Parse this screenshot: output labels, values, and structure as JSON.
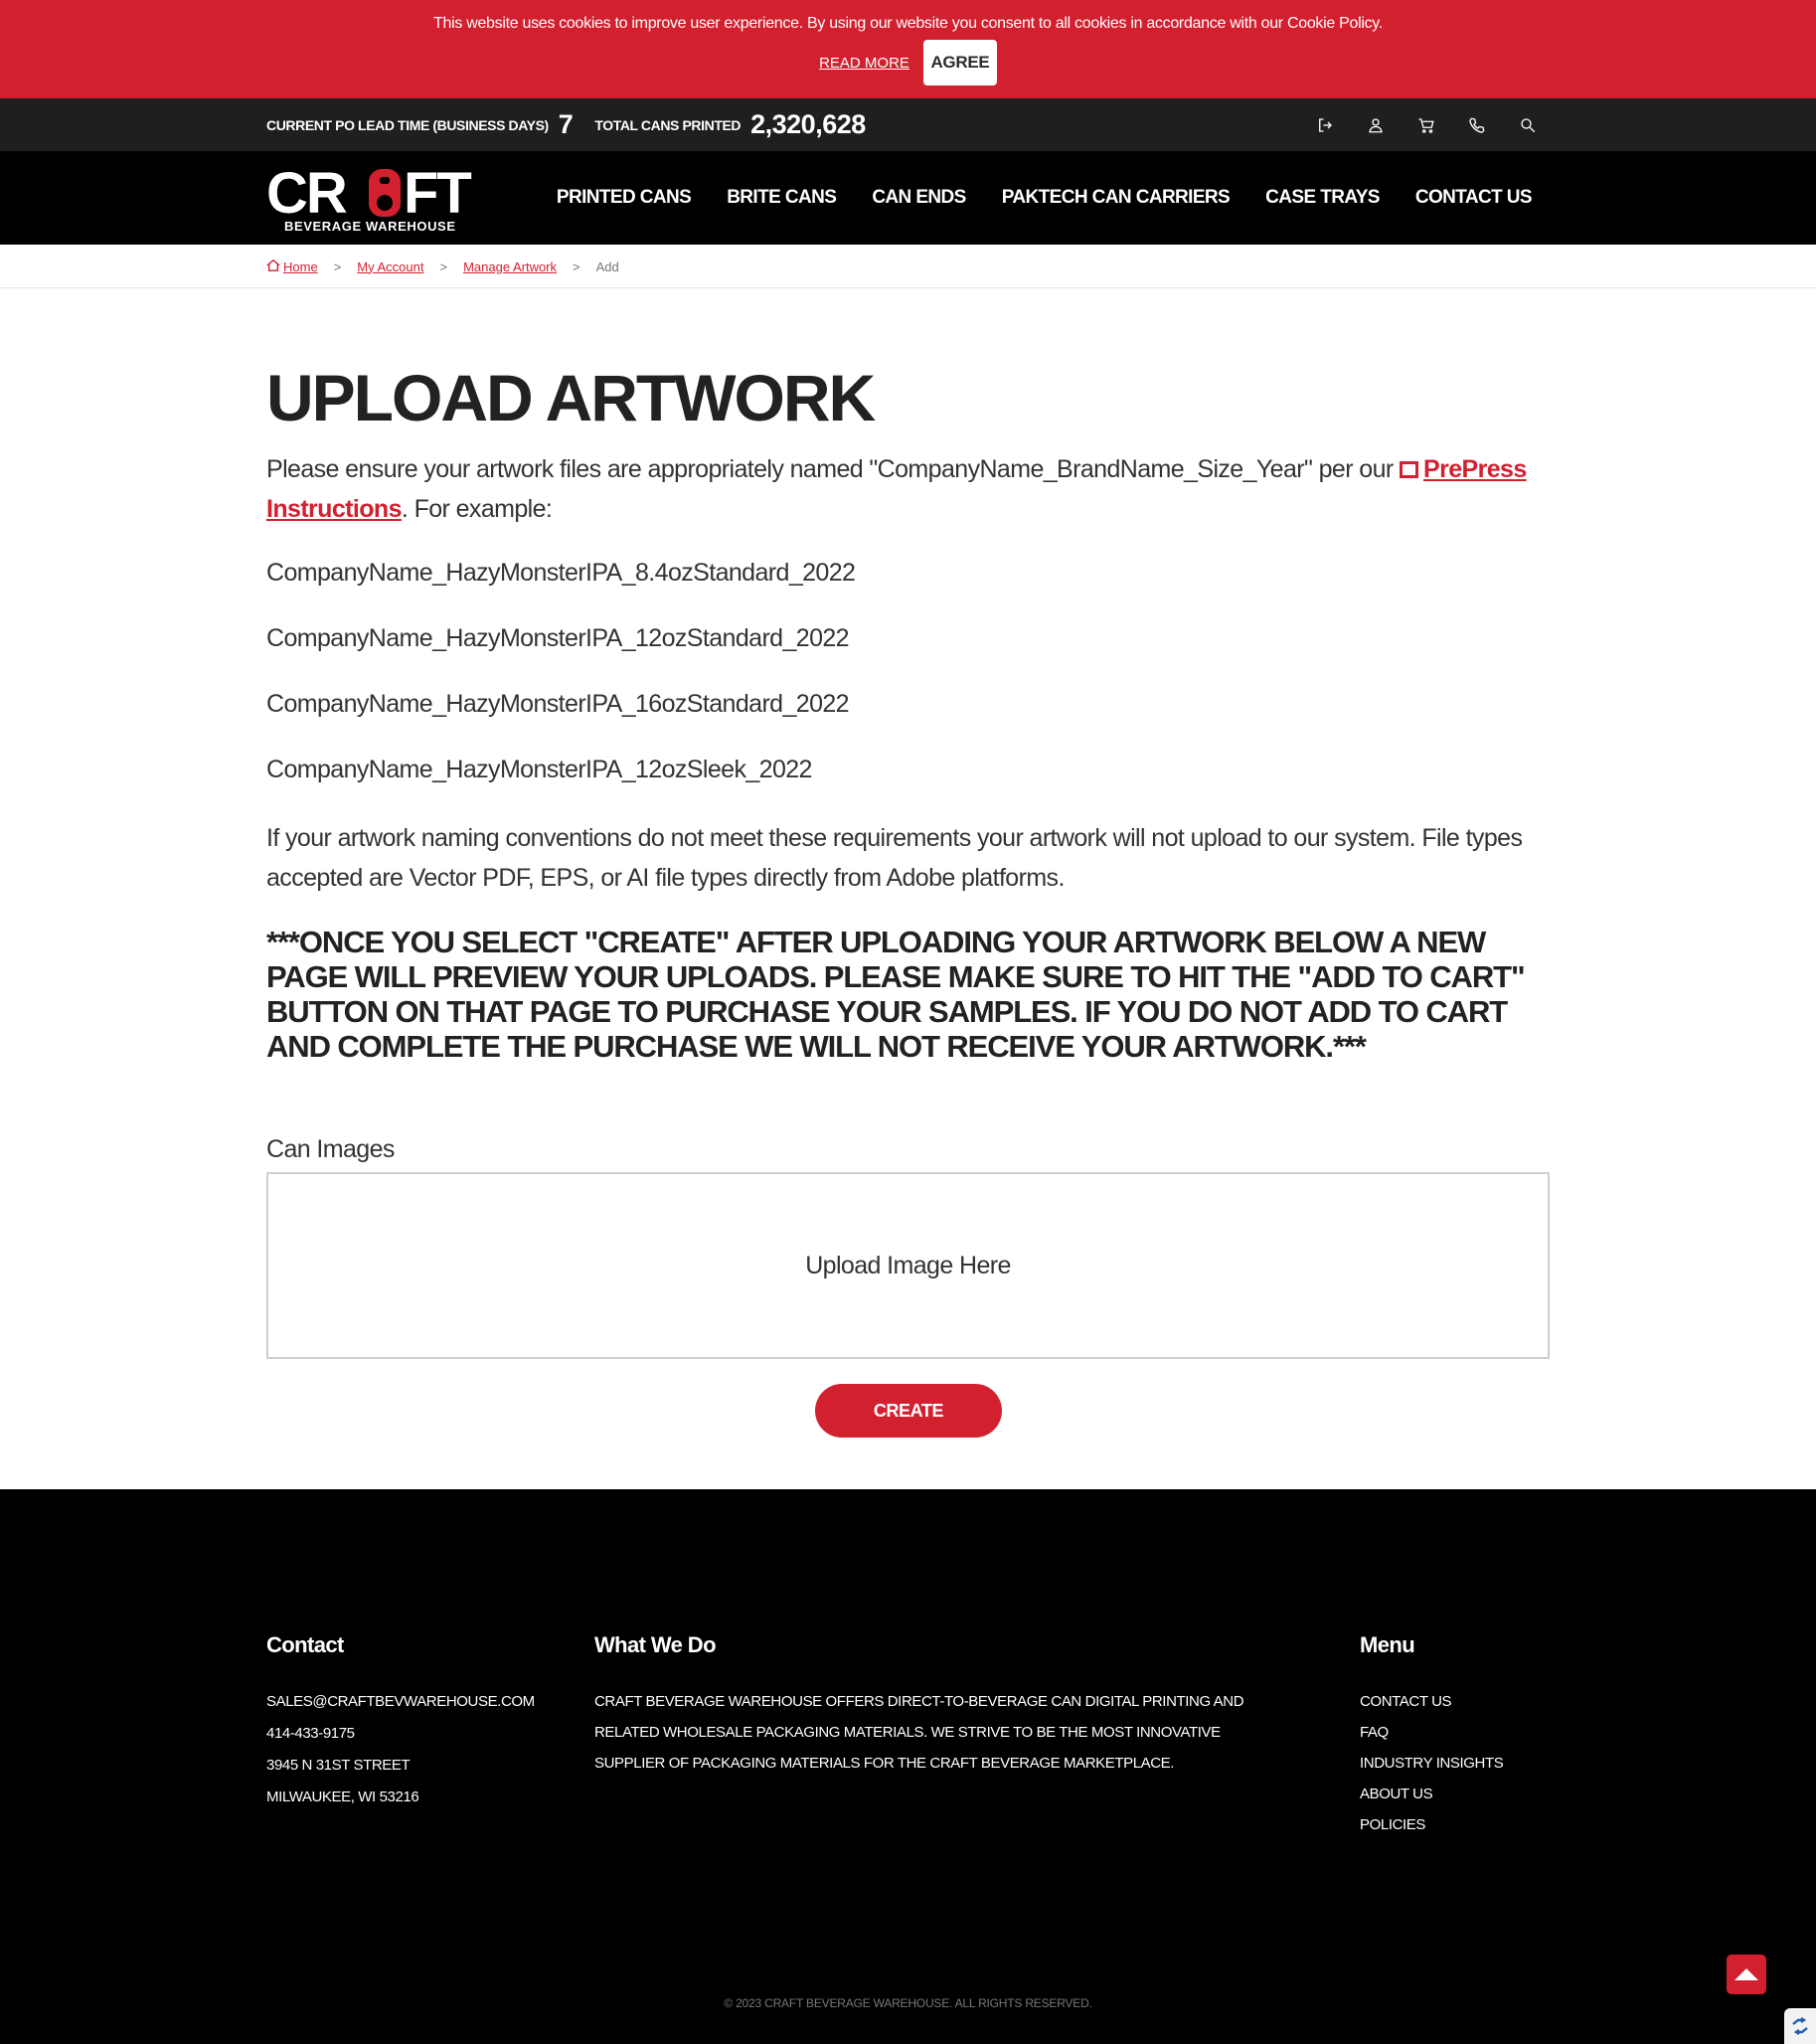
{
  "cookie_banner": {
    "message": "This website uses cookies to improve user experience. By using our website you consent to all cookies in accordance with our Cookie Policy.",
    "read_more": "READ MORE",
    "agree": "AGREE"
  },
  "stats": {
    "lead_time_label": "CURRENT PO LEAD TIME (BUSINESS DAYS)",
    "lead_time_value": "7",
    "cans_printed_label": "TOTAL CANS PRINTED",
    "cans_printed_value": "2,320,628"
  },
  "utility_icons": [
    "logout-icon",
    "user-icon",
    "cart-icon",
    "phone-icon",
    "search-icon"
  ],
  "logo": {
    "wordmark": "CRAFT",
    "tagline": "BEVERAGE WAREHOUSE"
  },
  "nav": [
    "PRINTED CANS",
    "BRITE CANS",
    "CAN ENDS",
    "PAKTECH CAN CARRIERS",
    "CASE TRAYS",
    "CONTACT US"
  ],
  "breadcrumb": {
    "home": "Home",
    "my_account": "My Account",
    "manage_artwork": "Manage Artwork",
    "current": "Add",
    "separator": ">"
  },
  "main": {
    "title": "UPLOAD ARTWORK",
    "intro_before": "Please ensure your artwork files are appropriately named \"CompanyName_BrandName_Size_Year\" per our ",
    "intro_link": "PrePress Instructions",
    "intro_after": ". For example:",
    "examples": [
      "CompanyName_HazyMonsterIPA_8.4ozStandard_2022",
      "CompanyName_HazyMonsterIPA_12ozStandard_2022",
      "CompanyName_HazyMonsterIPA_16ozStandard_2022",
      "CompanyName_HazyMonsterIPA_12ozSleek_2022"
    ],
    "note": "If your artwork naming conventions do not meet these requirements your artwork will not upload to our system. File types accepted are Vector PDF, EPS, or AI file types directly from Adobe platforms.",
    "warning": "***ONCE YOU SELECT \"CREATE\" AFTER UPLOADING YOUR ARTWORK BELOW A NEW PAGE WILL PREVIEW YOUR UPLOADS. PLEASE MAKE SURE TO HIT THE \"ADD TO CART\" BUTTON ON THAT PAGE TO PURCHASE YOUR SAMPLES. IF YOU DO NOT ADD TO CART AND COMPLETE THE PURCHASE WE WILL NOT RECEIVE YOUR ARTWORK.***",
    "field_label": "Can Images",
    "dropzone_text": "Upload Image Here",
    "create_button": "CREATE"
  },
  "footer": {
    "contact": {
      "heading": "Contact",
      "email": "SALES@CRAFTBEVWAREHOUSE.COM",
      "phone": "414-433-9175",
      "street": "3945 N 31ST STREET",
      "city": "MILWAUKEE, WI 53216"
    },
    "what_we_do": {
      "heading": "What We Do",
      "text": "CRAFT BEVERAGE WAREHOUSE OFFERS DIRECT-TO-BEVERAGE CAN DIGITAL PRINTING AND RELATED WHOLESALE PACKAGING MATERIALS. WE STRIVE TO BE THE MOST INNOVATIVE SUPPLIER OF PACKAGING MATERIALS FOR THE CRAFT BEVERAGE MARKETPLACE."
    },
    "menu": {
      "heading": "Menu",
      "items": [
        "CONTACT US",
        "FAQ",
        "INDUSTRY INSIGHTS",
        "ABOUT US",
        "POLICIES"
      ]
    },
    "copyright": "© 2023 CRAFT BEVERAGE WAREHOUSE. ALL RIGHTS RESERVED."
  },
  "colors": {
    "brand_red": "#d3202f",
    "stats_bar": "#1f1f1f",
    "header": "#000000",
    "footer": "#000000"
  }
}
